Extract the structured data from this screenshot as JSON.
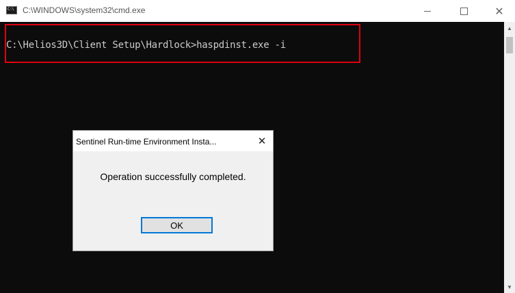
{
  "window": {
    "title": "C:\\WINDOWS\\system32\\cmd.exe",
    "icon_text": "C:\\",
    "minimize_glyph": "—",
    "close_glyph": "✕"
  },
  "console": {
    "command_line": "C:\\Helios3D\\Client Setup\\Hardlock>haspdinst.exe -i",
    "highlight_color": "#e0000f",
    "background_color": "#0c0c0c",
    "text_color": "#cccccc"
  },
  "scrollbar": {
    "up_arrow": "▲",
    "down_arrow": "▼"
  },
  "dialog": {
    "title": "Sentinel Run-time Environment Insta...",
    "close_glyph": "✕",
    "message": "Operation successfully completed.",
    "ok_label": "OK",
    "focus_color": "#0078d7"
  }
}
